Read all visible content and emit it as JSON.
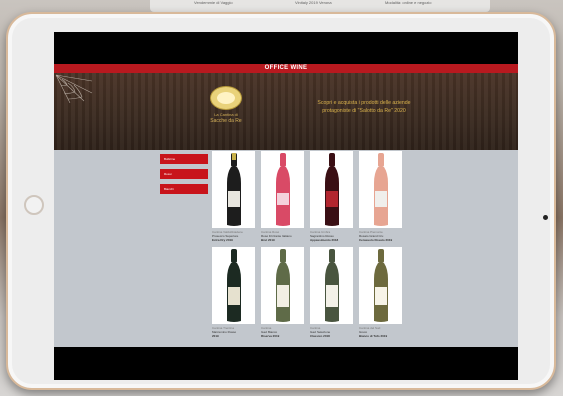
{
  "page": {
    "top_strip": {
      "col1": "Vendemmie di Vaggio",
      "col2": "Vinitaly 2019 Verona",
      "col3": "Modalità: online e negozio"
    }
  },
  "site": {
    "banner_label": "OFFICE WINE",
    "logo": {
      "line1": "La Cantina di",
      "line2": "Sacche da Re"
    },
    "hero_text": "Scopri e acquista i prodotti delle aziende protagoniste di \"Salotto da Re\" 2020",
    "sidebar_items": [
      "Bollicine",
      "Rossi",
      "Bianchi"
    ],
    "products": [
      {
        "producer": "Cantina Valdobbiadene",
        "name": "Prosecco Superiore",
        "vintage": "Extra Dry 2019",
        "bottle_color": "#1d1d1d",
        "label_color": "#e8e6df"
      },
      {
        "producer": "Cantina Rosé",
        "name": "Rosé Frizzante Italiano",
        "vintage": "Brut 2019",
        "bottle_color": "#d94a66",
        "label_color": "#f4d2dc"
      },
      {
        "producer": "Cantina Umbra",
        "name": "Sagrantino Rosso",
        "vintage": "Appassimento 2018",
        "bottle_color": "#3a0f14",
        "label_color": "#b2262f"
      },
      {
        "producer": "Cantina Piemonte",
        "name": "Rosato Grand Cru",
        "vintage": "Cerasuolo Rosato 2019",
        "bottle_color": "#e7a592",
        "label_color": "#f0efec"
      },
      {
        "producer": "Cantina Trentina",
        "name": "Marzemino Rosso",
        "vintage": "2019",
        "bottle_color": "#1c2a22",
        "label_color": "#e6e1cf"
      },
      {
        "producer": "Cantina",
        "name": "Gavi Bianco",
        "vintage": "Riserva 2019",
        "bottle_color": "#5f6b48",
        "label_color": "#f2efe4"
      },
      {
        "producer": "Cantina",
        "name": "Gavi Selezione",
        "vintage": "Classico 2018",
        "bottle_color": "#49553f",
        "label_color": "#f3f1e8"
      },
      {
        "producer": "Cantina del Sud",
        "name": "Greco",
        "vintage": "Bianco di Tufo 2019",
        "bottle_color": "#6d6a3e",
        "label_color": "#f7f4e8"
      }
    ]
  },
  "colors": {
    "accent_red": "#b8191f",
    "content_bg": "#c2c7cd",
    "hero_text": "#d9b24c"
  }
}
